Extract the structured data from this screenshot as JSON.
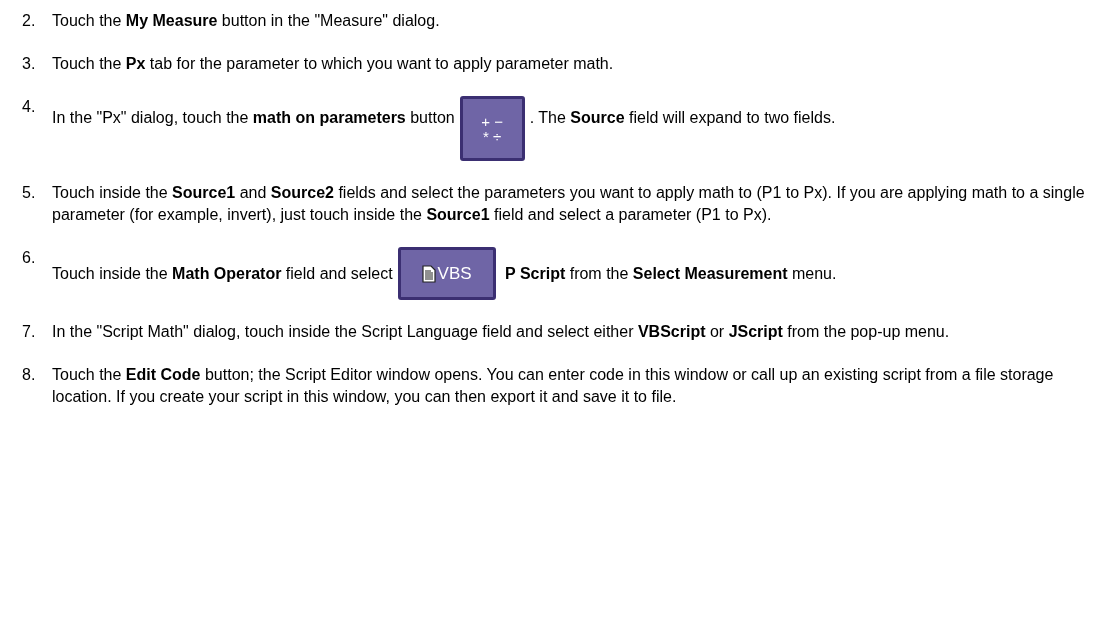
{
  "steps": [
    {
      "number": "2.",
      "segments": [
        {
          "kind": "text",
          "text": "Touch the **My Measure** button in the \"Measure\" dialog."
        }
      ]
    },
    {
      "number": "3.",
      "segments": [
        {
          "kind": "text",
          "text": "Touch the **Px** tab for the parameter to which you want to apply parameter math."
        }
      ]
    },
    {
      "number": "4.",
      "segments": [
        {
          "kind": "text",
          "text": "In the \"Px\" dialog, touch the **math on parameters** button"
        },
        {
          "kind": "math_button",
          "lines": [
            "+ −",
            "* ÷"
          ]
        },
        {
          "kind": "text",
          "text": ". The **Source** field will expand to two fields."
        }
      ]
    },
    {
      "number": "5.",
      "segments": [
        {
          "kind": "text",
          "text": "Touch inside the **Source1** and **Source2** fields and select the parameters you want to apply math to (P1 to Px). If you are applying math to a single parameter (for example, invert), just touch inside the **Source1** field and select a parameter (P1 to Px)."
        }
      ]
    },
    {
      "number": "6.",
      "segments": [
        {
          "kind": "text",
          "text": "Touch inside the **Math Operator** field and select"
        },
        {
          "kind": "script_button",
          "label": "VBS"
        },
        {
          "kind": "text",
          "text": "**P Script** from the **Select Measurement** menu."
        }
      ]
    },
    {
      "number": "7.",
      "segments": [
        {
          "kind": "text",
          "text": "In the \"Script Math\" dialog, touch inside the Script Language field and select either **VBScript** or **JScript** from the pop-up menu."
        }
      ]
    },
    {
      "number": "8.",
      "segments": [
        {
          "kind": "text",
          "text": "Touch the **Edit Code** button; the Script Editor window opens. You can enter code in this window or call up an existing script from a file storage location. If you create your script in this window, you can then export it and save it to file."
        }
      ]
    }
  ]
}
